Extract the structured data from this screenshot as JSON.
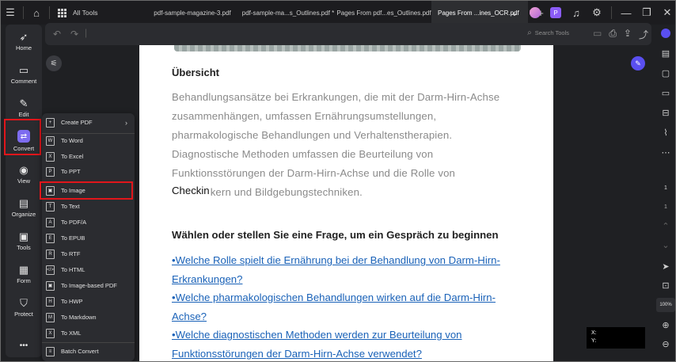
{
  "titlebar": {
    "all_tools": "All Tools",
    "tabs": [
      {
        "label": "pdf-sample-magazine-3.pdf"
      },
      {
        "label": "pdf-sample-ma...s_Outlines.pdf *"
      },
      {
        "label": "Pages From pdf...es_Outlines.pdf"
      },
      {
        "label": "Pages From ...ines_OCR.pdf"
      }
    ],
    "pro_badge": "P"
  },
  "toolbar": {
    "search_label": "Search Tools"
  },
  "sidebar": {
    "items": [
      {
        "label": "Home",
        "icon": "rocket-icon"
      },
      {
        "label": "Comment",
        "icon": "comment-icon"
      },
      {
        "label": "Edit",
        "icon": "edit-icon"
      },
      {
        "label": "Convert",
        "icon": "convert-icon"
      },
      {
        "label": "View",
        "icon": "eye-icon"
      },
      {
        "label": "Organize",
        "icon": "organize-icon"
      },
      {
        "label": "Tools",
        "icon": "toolbox-icon"
      },
      {
        "label": "Form",
        "icon": "form-icon"
      },
      {
        "label": "Protect",
        "icon": "shield-icon"
      },
      {
        "label": "•••",
        "icon": "more-icon"
      }
    ]
  },
  "convert_menu": {
    "items": [
      {
        "label": "Create PDF",
        "icon": "create-pdf-icon",
        "glyph": "+"
      },
      {
        "label": "To Word",
        "icon": "word-icon",
        "glyph": "W"
      },
      {
        "label": "To Excel",
        "icon": "excel-icon",
        "glyph": "X"
      },
      {
        "label": "To PPT",
        "icon": "ppt-icon",
        "glyph": "P"
      },
      {
        "label": "To Image",
        "icon": "image-icon",
        "glyph": "▣"
      },
      {
        "label": "To Text",
        "icon": "text-icon",
        "glyph": "T"
      },
      {
        "label": "To PDF/A",
        "icon": "pdfa-icon",
        "glyph": "A"
      },
      {
        "label": "To EPUB",
        "icon": "epub-icon",
        "glyph": "E"
      },
      {
        "label": "To RTF",
        "icon": "rtf-icon",
        "glyph": "R"
      },
      {
        "label": "To HTML",
        "icon": "html-icon",
        "glyph": "</>"
      },
      {
        "label": "To Image-based PDF",
        "icon": "image-pdf-icon",
        "glyph": "▣"
      },
      {
        "label": "To HWP",
        "icon": "hwp-icon",
        "glyph": "H"
      },
      {
        "label": "To Markdown",
        "icon": "markdown-icon",
        "glyph": "M"
      },
      {
        "label": "To XML",
        "icon": "xml-icon",
        "glyph": "X"
      },
      {
        "label": "Batch Convert",
        "icon": "batch-icon",
        "glyph": "≡"
      }
    ]
  },
  "document": {
    "heading": "Übersicht",
    "paragraph_lines": [
      "Behandlungsansätze bei Erkrankungen, die mit der Darm-Hirn-Achse",
      "zusammenhängen, umfassen Ernährungsumstellungen,",
      "pharmakologische Behandlungen und Verhaltenstherapien.",
      "Diagnostische Methoden umfassen die Beurteilung von",
      "Funktionsstörungen der Darm-Hirn-Achse und die Rolle von",
      "Checkinkern und Bildgebungstechniken."
    ],
    "overlay_word": "Checkin",
    "question_heading": "Wählen oder stellen Sie eine Frage, um ein Gespräch zu beginnen",
    "questions": [
      [
        "•Welche Rolle spielt die Ernährung bei der Behandlung von Darm-Hirn-",
        "Erkrankungen?"
      ],
      [
        "•Welche pharmakologischen Behandlungen wirken auf die Darm-Hirn-",
        "Achse?"
      ],
      [
        "•Welche diagnostischen Methoden werden zur Beurteilung von",
        "Funktionsstörungen der Darm-Hirn-Achse verwendet?"
      ]
    ]
  },
  "right_sidebar": {
    "page_current": "1",
    "page_total": "1",
    "zoom": "100%"
  },
  "coords": {
    "x_label": "X:",
    "y_label": "Y:"
  },
  "colors": {
    "accent": "#7d6cf0",
    "highlight": "#e1161b",
    "link": "#1a62b8"
  }
}
